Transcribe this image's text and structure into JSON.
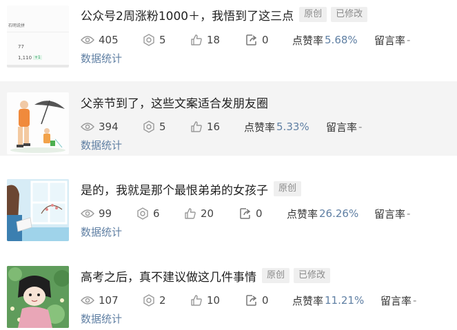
{
  "labels": {
    "like_rate": "点赞率",
    "reply_rate": "留言率",
    "reply_placeholder": "-",
    "data_stats": "数据统计"
  },
  "thumb0_text": {
    "name": "石明说拼",
    "v1": "77",
    "v2": "1,110",
    "chip": "+1"
  },
  "articles": [
    {
      "title": "公众号2周涨粉1000＋，我悟到了这三点",
      "tags": [
        "原创",
        "已修改"
      ],
      "views": "405",
      "shares": "5",
      "likes": "18",
      "forwards": "0",
      "like_rate": "5.68%"
    },
    {
      "title": "父亲节到了，这些文案适合发朋友圈",
      "tags": [],
      "views": "394",
      "shares": "5",
      "likes": "16",
      "like_rate": "5.33%"
    },
    {
      "title": "是的，我就是那个最恨弟弟的女孩子",
      "tags": [
        "原创"
      ],
      "views": "99",
      "shares": "6",
      "likes": "20",
      "forwards": "0",
      "like_rate": "26.26%"
    },
    {
      "title": "高考之后，真不建议做这几件事情",
      "tags": [
        "原创",
        "已修改"
      ],
      "views": "107",
      "shares": "2",
      "likes": "10",
      "forwards": "0",
      "like_rate": "11.21%"
    }
  ]
}
